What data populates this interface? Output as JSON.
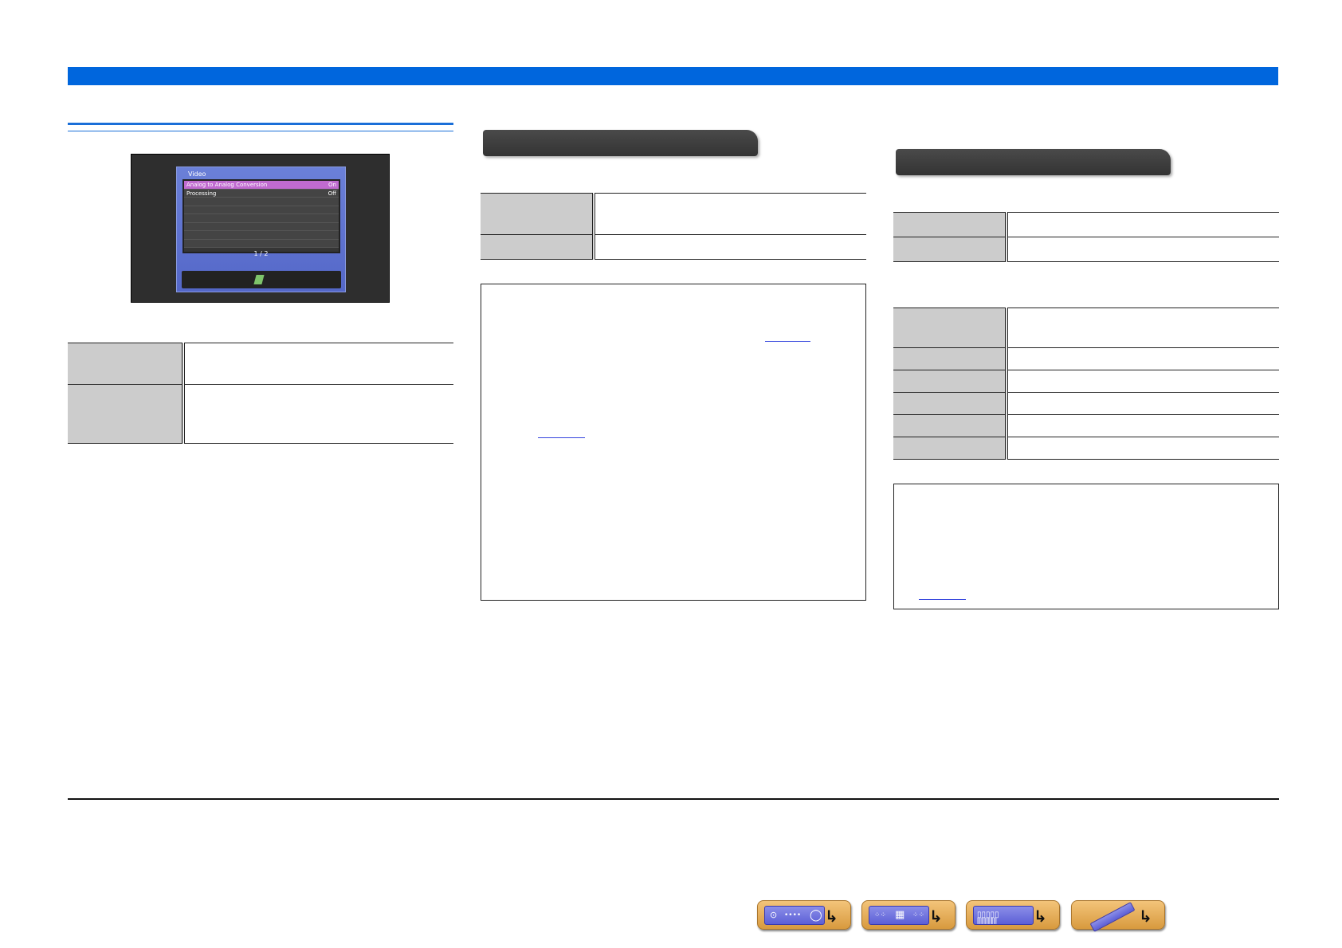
{
  "osd": {
    "title": "Video",
    "rows": [
      {
        "label": "Analog to Analog Conversion",
        "value": "On"
      },
      {
        "label": "Processing",
        "value": "Off"
      }
    ],
    "page": "1 / 2"
  },
  "icons": {
    "nav_front_panel": "front-panel-icon",
    "nav_rear_panel": "rear-panel-icon",
    "nav_display": "front-display-icon",
    "nav_remote": "remote-control-icon",
    "arrow": "return-arrow-icon"
  },
  "colors": {
    "accent": "#0066dd",
    "table_key_bg": "#cccccc",
    "nav_button": "#e6ad56"
  }
}
